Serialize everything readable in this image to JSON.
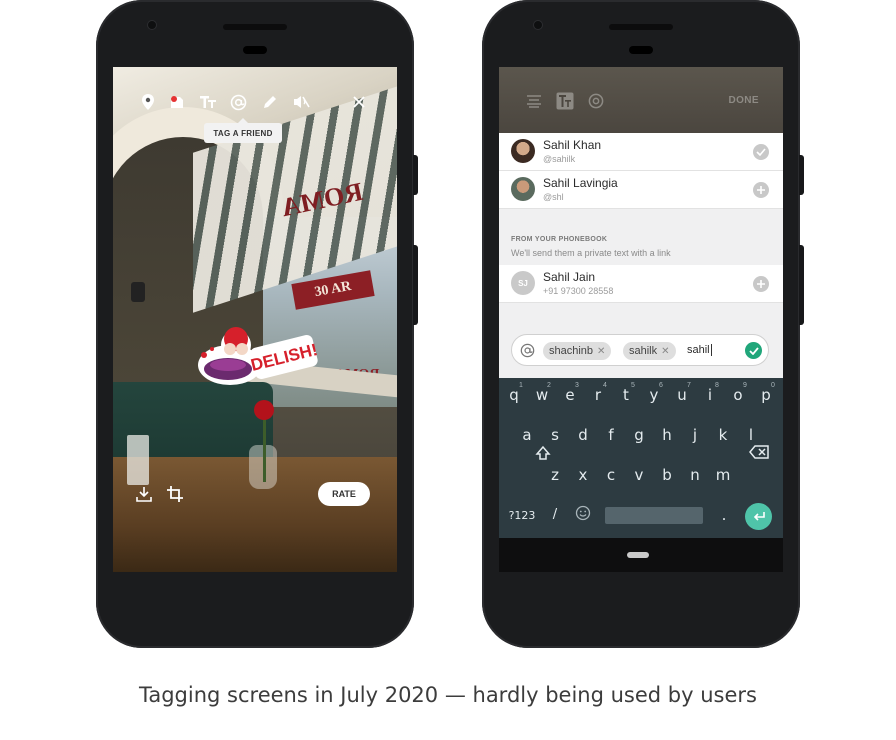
{
  "left_phone": {
    "toolbar": {
      "icons": [
        "location-pin-icon",
        "sticker-icon",
        "text-icon",
        "mention-icon",
        "pencil-icon",
        "mute-icon",
        "close-icon"
      ]
    },
    "tooltip": "TAG A FRIEND",
    "sticker_text": "DELISH!",
    "scene_text": {
      "roma": "ROMA",
      "bar": "30 AR",
      "roma_small": "ROMA"
    },
    "rate_button": "RATE"
  },
  "right_phone": {
    "toolbar": {
      "done": "DONE"
    },
    "contacts": [
      {
        "name": "Sahil Khan",
        "handle": "@sahilk",
        "state": "selected"
      },
      {
        "name": "Sahil Lavingia",
        "handle": "@shl",
        "state": "add"
      }
    ],
    "phonebook": {
      "title": "FROM YOUR PHONEBOOK",
      "subtitle": "We'll send them a private text with a link",
      "contact": {
        "initials": "SJ",
        "name": "Sahil Jain",
        "phone": "+91 97300 28558"
      }
    },
    "input": {
      "chips": [
        "shachinb",
        "sahilk"
      ],
      "typed": "sahil"
    },
    "keyboard": {
      "row1": [
        "q",
        "w",
        "e",
        "r",
        "t",
        "y",
        "u",
        "i",
        "o",
        "p"
      ],
      "row1_nums": [
        "1",
        "2",
        "3",
        "4",
        "5",
        "6",
        "7",
        "8",
        "9",
        "0"
      ],
      "row2": [
        "a",
        "s",
        "d",
        "f",
        "g",
        "h",
        "j",
        "k",
        "l"
      ],
      "row3": [
        "z",
        "x",
        "c",
        "v",
        "b",
        "n",
        "m"
      ],
      "symbols_key": "?123",
      "slash_key": "/",
      "period_key": "."
    }
  },
  "caption": "Tagging screens in July 2020 — hardly being used by users",
  "colors": {
    "accent_green": "#20a67a",
    "enter_key": "#4fc4a9",
    "keyboard_bg": "#2d3b41"
  }
}
